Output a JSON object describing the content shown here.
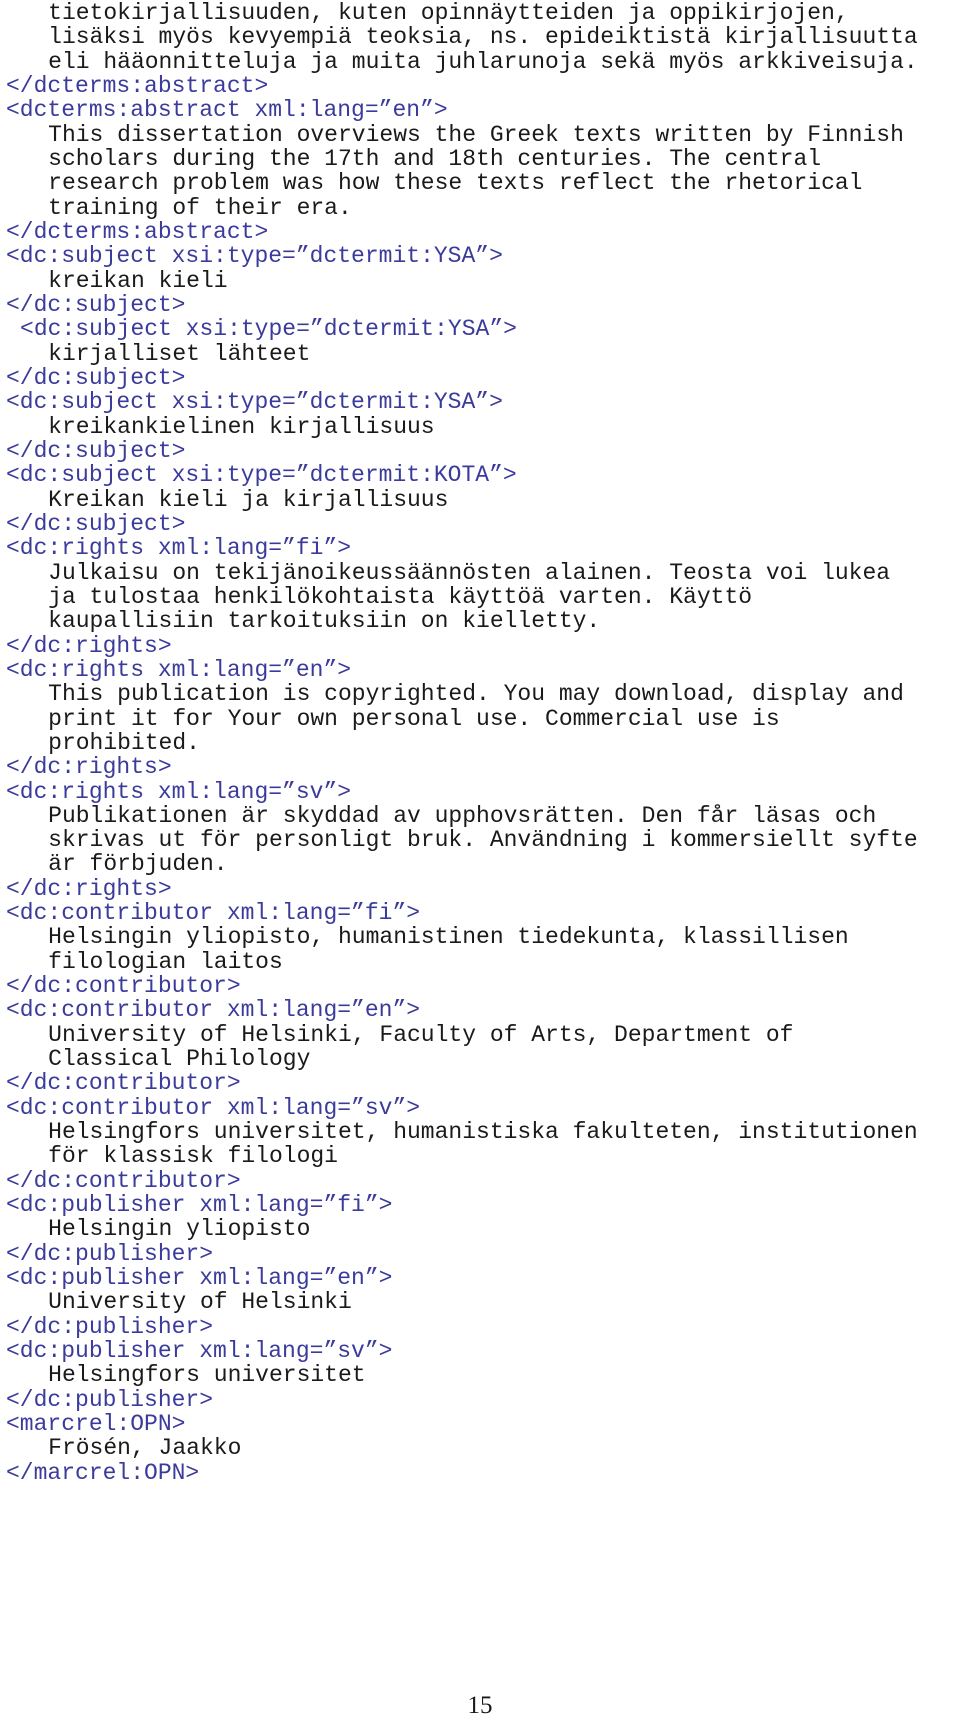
{
  "document": {
    "page_number": "15",
    "colors": {
      "tag": "#3b3b9c",
      "text": "#1a1a1a",
      "background": "#ffffff"
    },
    "lines": [
      {
        "kind": "text",
        "indent": 3,
        "content": "tietokirjallisuuden, kuten opinnäytteiden ja oppikirjojen,"
      },
      {
        "kind": "text",
        "indent": 3,
        "content": "lisäksi myös kevyempiä teoksia, ns. epideiktistä kirjallisuutta"
      },
      {
        "kind": "text",
        "indent": 3,
        "content": "eli hääonnitteluja ja muita juhlarunoja sekä myös arkkiveisuja."
      },
      {
        "kind": "tag",
        "indent": 0,
        "content": "</dcterms:abstract>"
      },
      {
        "kind": "tag",
        "indent": 0,
        "content": "<dcterms:abstract xml:lang=”en”>"
      },
      {
        "kind": "text",
        "indent": 3,
        "content": "This dissertation overviews the Greek texts written by Finnish"
      },
      {
        "kind": "text",
        "indent": 3,
        "content": "scholars during the 17th and 18th centuries. The central"
      },
      {
        "kind": "text",
        "indent": 3,
        "content": "research problem was how these texts reflect the rhetorical"
      },
      {
        "kind": "text",
        "indent": 3,
        "content": "training of their era."
      },
      {
        "kind": "tag",
        "indent": 0,
        "content": "</dcterms:abstract>"
      },
      {
        "kind": "tag",
        "indent": 0,
        "content": "<dc:subject xsi:type=”dctermit:YSA”>"
      },
      {
        "kind": "text",
        "indent": 3,
        "content": "kreikan kieli"
      },
      {
        "kind": "tag",
        "indent": 0,
        "content": "</dc:subject>"
      },
      {
        "kind": "tag",
        "indent": 1,
        "content": "<dc:subject xsi:type=”dctermit:YSA”>"
      },
      {
        "kind": "text",
        "indent": 3,
        "content": "kirjalliset lähteet"
      },
      {
        "kind": "tag",
        "indent": 0,
        "content": "</dc:subject>"
      },
      {
        "kind": "tag",
        "indent": 0,
        "content": "<dc:subject xsi:type=”dctermit:YSA”>"
      },
      {
        "kind": "text",
        "indent": 3,
        "content": "kreikankielinen kirjallisuus"
      },
      {
        "kind": "tag",
        "indent": 0,
        "content": "</dc:subject>"
      },
      {
        "kind": "tag",
        "indent": 0,
        "content": "<dc:subject xsi:type=”dctermit:KOTA”>"
      },
      {
        "kind": "text",
        "indent": 3,
        "content": "Kreikan kieli ja kirjallisuus"
      },
      {
        "kind": "tag",
        "indent": 0,
        "content": "</dc:subject>"
      },
      {
        "kind": "tag",
        "indent": 0,
        "content": "<dc:rights xml:lang=”fi”>"
      },
      {
        "kind": "text",
        "indent": 3,
        "content": "Julkaisu on tekijänoikeussäännösten alainen. Teosta voi lukea"
      },
      {
        "kind": "text",
        "indent": 3,
        "content": "ja tulostaa henkilökohtaista käyttöä varten. Käyttö"
      },
      {
        "kind": "text",
        "indent": 3,
        "content": "kaupallisiin tarkoituksiin on kielletty."
      },
      {
        "kind": "tag",
        "indent": 0,
        "content": "</dc:rights>"
      },
      {
        "kind": "tag",
        "indent": 0,
        "content": "<dc:rights xml:lang=”en”>"
      },
      {
        "kind": "text",
        "indent": 3,
        "content": "This publication is copyrighted. You may download, display and"
      },
      {
        "kind": "text",
        "indent": 3,
        "content": "print it for Your own personal use. Commercial use is"
      },
      {
        "kind": "text",
        "indent": 3,
        "content": "prohibited."
      },
      {
        "kind": "tag",
        "indent": 0,
        "content": "</dc:rights>"
      },
      {
        "kind": "tag",
        "indent": 0,
        "content": "<dc:rights xml:lang=”sv”>"
      },
      {
        "kind": "text",
        "indent": 3,
        "content": "Publikationen är skyddad av upphovsrätten. Den får läsas och"
      },
      {
        "kind": "text",
        "indent": 3,
        "content": "skrivas ut för personligt bruk. Användning i kommersiellt syfte"
      },
      {
        "kind": "text",
        "indent": 3,
        "content": "är förbjuden."
      },
      {
        "kind": "tag",
        "indent": 0,
        "content": "</dc:rights>"
      },
      {
        "kind": "tag",
        "indent": 0,
        "content": "<dc:contributor xml:lang=”fi”>"
      },
      {
        "kind": "text",
        "indent": 3,
        "content": "Helsingin yliopisto, humanistinen tiedekunta, klassillisen"
      },
      {
        "kind": "text",
        "indent": 3,
        "content": "filologian laitos"
      },
      {
        "kind": "tag",
        "indent": 0,
        "content": "</dc:contributor>"
      },
      {
        "kind": "tag",
        "indent": 0,
        "content": "<dc:contributor xml:lang=”en”>"
      },
      {
        "kind": "text",
        "indent": 3,
        "content": "University of Helsinki, Faculty of Arts, Department of"
      },
      {
        "kind": "text",
        "indent": 3,
        "content": "Classical Philology"
      },
      {
        "kind": "tag",
        "indent": 0,
        "content": "</dc:contributor>"
      },
      {
        "kind": "tag",
        "indent": 0,
        "content": "<dc:contributor xml:lang=”sv”>"
      },
      {
        "kind": "text",
        "indent": 3,
        "content": "Helsingfors universitet, humanistiska fakulteten, institutionen"
      },
      {
        "kind": "text",
        "indent": 3,
        "content": "för klassisk filologi"
      },
      {
        "kind": "tag",
        "indent": 0,
        "content": "</dc:contributor>"
      },
      {
        "kind": "tag",
        "indent": 0,
        "content": "<dc:publisher xml:lang=”fi”>"
      },
      {
        "kind": "text",
        "indent": 3,
        "content": "Helsingin yliopisto"
      },
      {
        "kind": "tag",
        "indent": 0,
        "content": "</dc:publisher>"
      },
      {
        "kind": "tag",
        "indent": 0,
        "content": "<dc:publisher xml:lang=”en”>"
      },
      {
        "kind": "text",
        "indent": 3,
        "content": "University of Helsinki"
      },
      {
        "kind": "tag",
        "indent": 0,
        "content": "</dc:publisher>"
      },
      {
        "kind": "tag",
        "indent": 0,
        "content": "<dc:publisher xml:lang=”sv”>"
      },
      {
        "kind": "text",
        "indent": 3,
        "content": "Helsingfors universitet"
      },
      {
        "kind": "tag",
        "indent": 0,
        "content": "</dc:publisher>"
      },
      {
        "kind": "tag",
        "indent": 0,
        "content": "<marcrel:OPN>"
      },
      {
        "kind": "text",
        "indent": 3,
        "content": "Frösén, Jaakko"
      },
      {
        "kind": "tag",
        "indent": 0,
        "content": "</marcrel:OPN>"
      }
    ]
  }
}
